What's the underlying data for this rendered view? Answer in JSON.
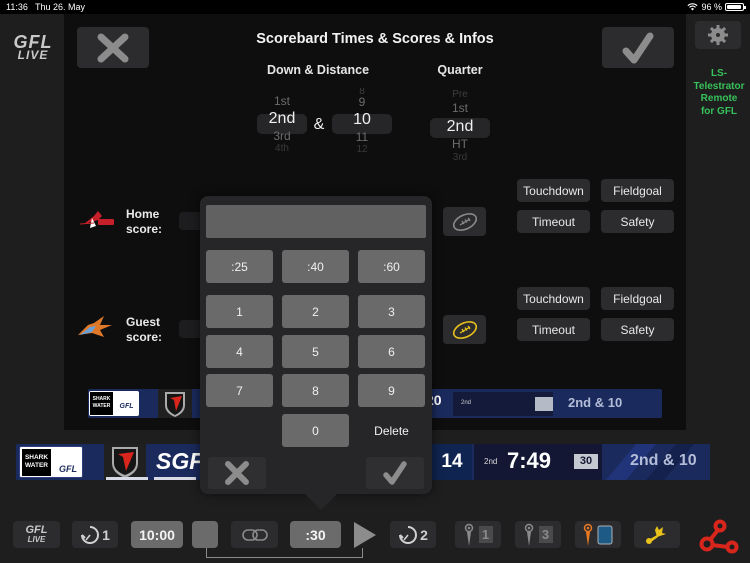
{
  "status_bar": {
    "time": "11:36",
    "date": "Thu 26. May",
    "battery_text": "96 %",
    "battery_level": 0.96,
    "icons": [
      "wifi-icon",
      "battery-icon"
    ]
  },
  "app": {
    "logo_line1": "GFL",
    "logo_line2": "LIVE",
    "title": "Scorebard Times & Scores & Infos",
    "telestrator_label": "LS-Telestrator Remote for GFL",
    "telestrator_lines": [
      "LS-",
      "Telestrator",
      "Remote",
      "for GFL"
    ],
    "accent_color": "#37c15a"
  },
  "header_buttons": {
    "close_icon": "close-icon",
    "confirm_icon": "checkmark-icon",
    "settings_icon": "gear-icon"
  },
  "down_distance": {
    "label": "Down & Distance",
    "ampersand": "&",
    "down_options": [
      "1st",
      "2nd",
      "3rd",
      "4th"
    ],
    "down_selected": "2nd",
    "distance_options": [
      "8",
      "9",
      "10",
      "11",
      "12"
    ],
    "distance_selected": "10"
  },
  "quarter": {
    "label": "Quarter",
    "options": [
      "Pre",
      "1st",
      "2nd",
      "HT",
      "3rd"
    ],
    "selected": "2nd"
  },
  "home": {
    "label_line1": "Home",
    "label_line2": "score:",
    "possession": false,
    "actions": [
      "Touchdown",
      "Fieldgoal",
      "Timeout",
      "Safety"
    ]
  },
  "guest": {
    "label_line1": "Guest",
    "label_line2": "score:",
    "possession": true,
    "actions": [
      "Touchdown",
      "Fieldgoal",
      "Timeout",
      "Safety"
    ]
  },
  "colors": {
    "possession_active": "#e8c21a",
    "possession_inactive": "#8a8a8a",
    "scoreboard_navy": "#1a2a5c",
    "red_accent": "#d8261c"
  },
  "keypad": {
    "display_value": "",
    "presets": [
      ":25",
      ":40",
      ":60"
    ],
    "digits": [
      "1",
      "2",
      "3",
      "4",
      "5",
      "6",
      "7",
      "8",
      "9"
    ],
    "zero": "0",
    "delete_label": "Delete"
  },
  "scoreboard_mini": {
    "sponsor": "SHARK WATER",
    "league": "GFL",
    "guest_score": "20",
    "quarter": "2nd",
    "down_distance": "2nd & 10"
  },
  "scoreboard_main": {
    "sponsor": "SHARK WATER",
    "league": "GFL",
    "home_abbr": "SGF",
    "guest_score": "14",
    "quarter": "2nd",
    "clock": "7:49",
    "play_clock": "30",
    "down_distance": "2nd & 10"
  },
  "toolbar": {
    "gfl_live_line1": "GFL",
    "gfl_live_line2": "LIVE",
    "timeout_home_count": "1",
    "game_clock": "10:00",
    "play_clock": ":30",
    "timeout_guest_count": "2",
    "marker1_value": "1",
    "marker2_value": "3",
    "icons": [
      "gfl-live-logo",
      "timeout-clock-icon",
      "stop-icon",
      "link-icon",
      "play-icon",
      "marker-icon",
      "flag-icon",
      "network-icon"
    ]
  }
}
